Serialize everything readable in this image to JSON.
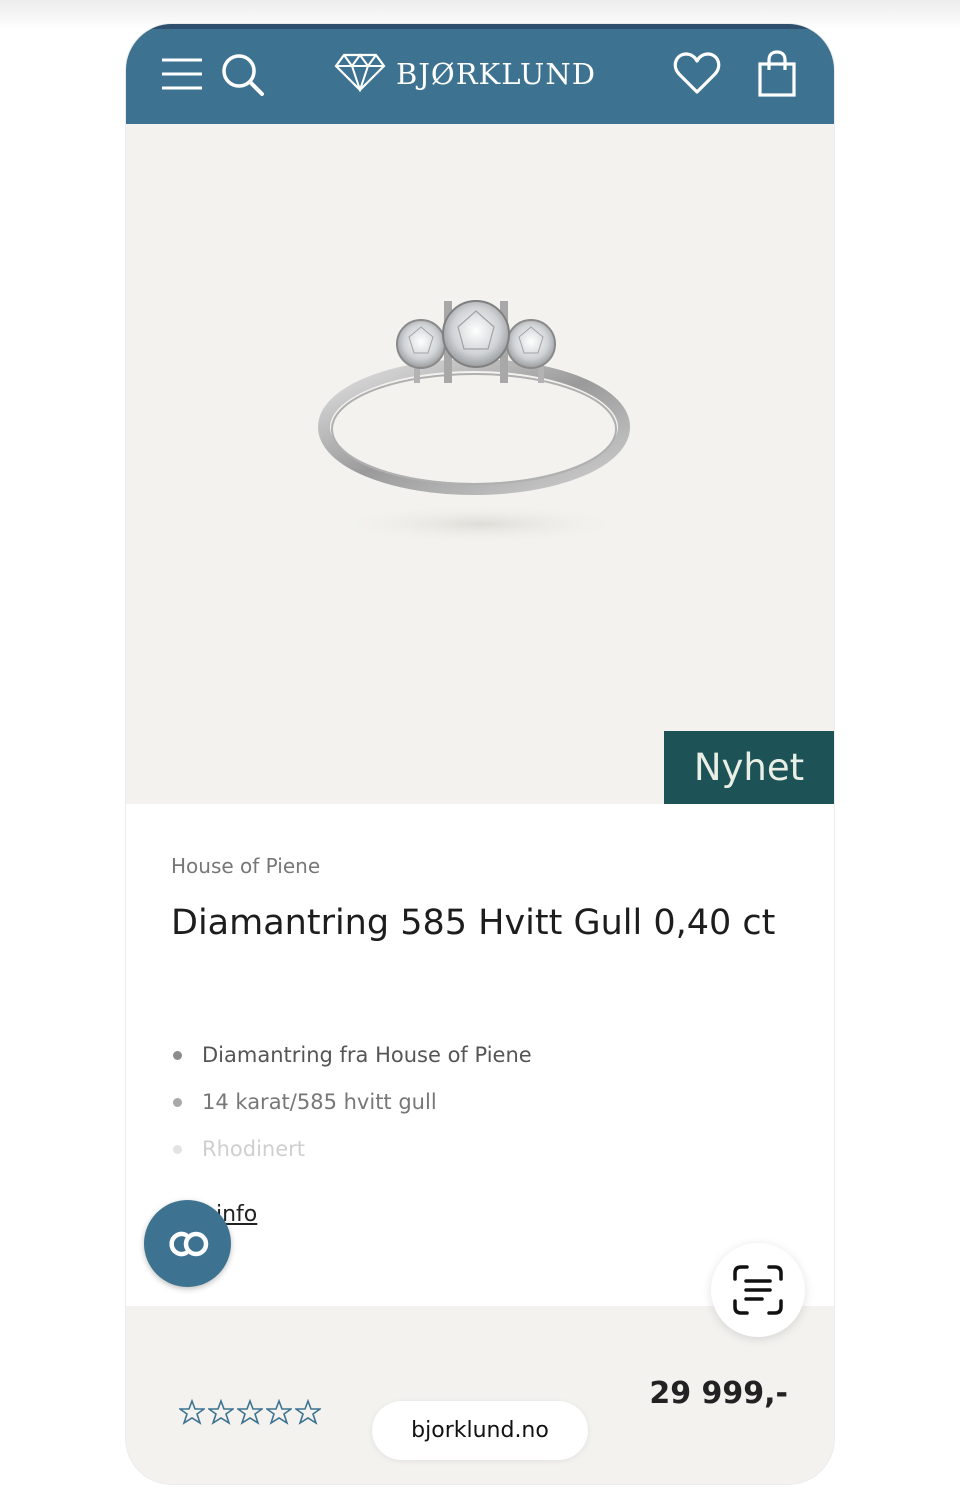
{
  "header": {
    "brand_name": "BJØRKLUND",
    "background_color": "#3d7391",
    "icons": [
      "menu-icon",
      "search-icon",
      "diamond-logo-icon",
      "heart-icon",
      "shopping-bag-icon"
    ]
  },
  "product": {
    "badge": "Nyhet",
    "brand": "House of Piene",
    "title": "Diamantring 585 Hvitt Gull 0,40 ct",
    "bullets": [
      "Diamantring fra House of Piene",
      "14 karat/585 hvitt gull",
      "Rhodinert"
    ],
    "more_link": "info",
    "price": "29 999,-",
    "rating_stars": 5,
    "rating_filled": 0
  },
  "floating": {
    "co_label": "CO",
    "url": "bjorklund.no"
  },
  "colors": {
    "header": "#3d7391",
    "badge": "#1d5356",
    "hero_bg": "#f3f2ee"
  }
}
